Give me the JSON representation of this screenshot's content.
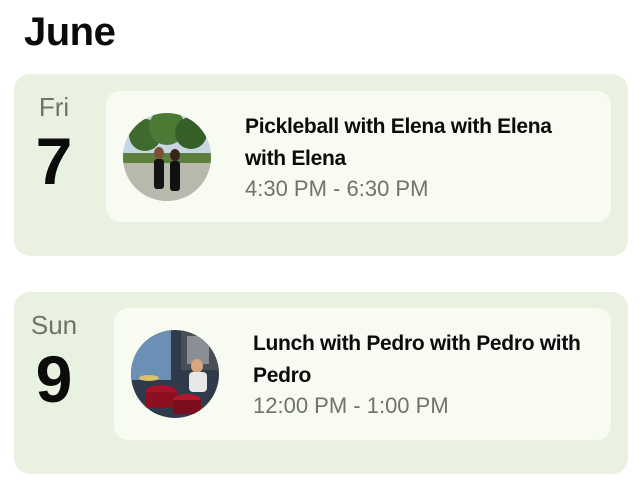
{
  "month": "June",
  "days": [
    {
      "weekday": "Fri",
      "day": "7",
      "event": {
        "title": "Pickleball with Elena with Elena with Elena",
        "time": "4:30 PM - 6:30 PM",
        "avatar": "photo-two-women-outdoors"
      }
    },
    {
      "weekday": "Sun",
      "day": "9",
      "event": {
        "title": "Lunch with Pedro with Pedro with Pedro",
        "time": "12:00 PM - 1:00 PM",
        "avatar": "photo-man-at-drum-kit"
      }
    }
  ],
  "colors": {
    "day_card_bg": "#e9f1e1",
    "event_card_bg": "#f7fbf1",
    "secondary_text": "#6f7368",
    "primary_text": "#0b0b0b"
  }
}
